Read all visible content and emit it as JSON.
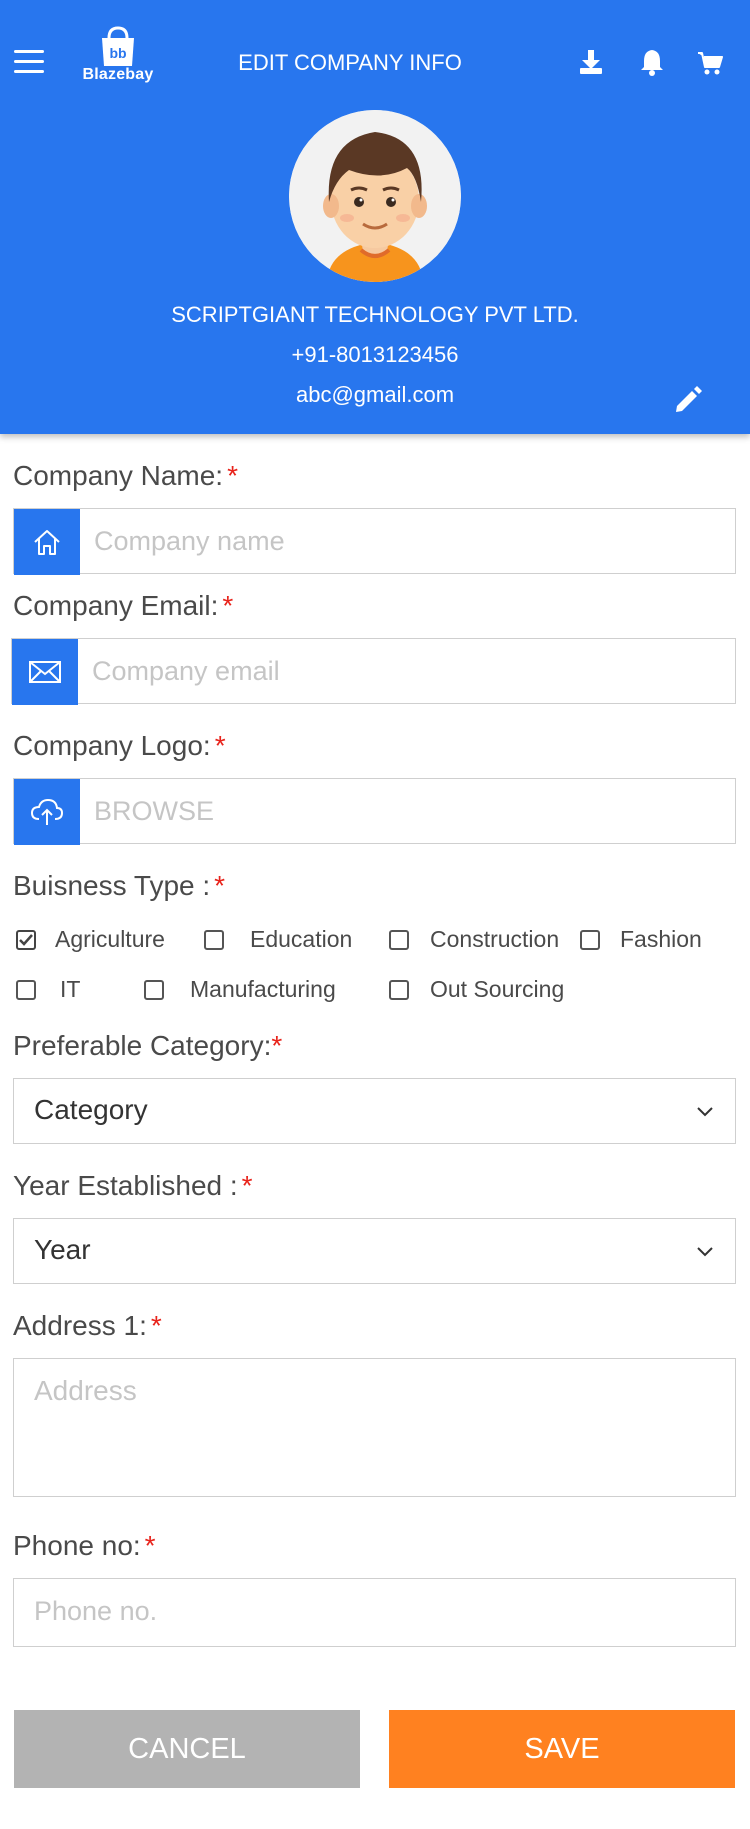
{
  "header": {
    "title": "EDIT COMPANY INFO",
    "logo_text": "Blazebay",
    "company_name": "SCRIPTGIANT TECHNOLOGY PVT LTD.",
    "phone": "+91-8013123456",
    "email": "abc@gmail.com"
  },
  "form": {
    "company_name": {
      "label": "Company Name:",
      "required": "*",
      "placeholder": "Company name",
      "icon": "home-icon"
    },
    "company_email": {
      "label": "Company Email:",
      "required": "*",
      "placeholder": "Company email",
      "icon": "envelope-icon"
    },
    "company_logo": {
      "label": "Company Logo:",
      "required": "*",
      "placeholder": "BROWSE",
      "icon": "cloud-upload-icon"
    },
    "business_type": {
      "label": "Buisness Type :",
      "required": "*",
      "options": [
        {
          "label": "Agriculture",
          "checked": true
        },
        {
          "label": "Education",
          "checked": false
        },
        {
          "label": "Construction",
          "checked": false
        },
        {
          "label": "Fashion",
          "checked": false
        },
        {
          "label": "IT",
          "checked": false
        },
        {
          "label": "Manufacturing",
          "checked": false
        },
        {
          "label": "Out Sourcing",
          "checked": false
        }
      ]
    },
    "category": {
      "label": "Preferable Category:",
      "required": "*",
      "value": "Category"
    },
    "year": {
      "label": "Year Established :",
      "required": "*",
      "value": "Year"
    },
    "address": {
      "label": "Address 1:",
      "required": "*",
      "placeholder": "Address"
    },
    "phone": {
      "label": "Phone no:",
      "required": "*",
      "placeholder": "Phone no."
    }
  },
  "actions": {
    "cancel": "CANCEL",
    "save": "SAVE"
  },
  "colors": {
    "primary": "#2876ee",
    "accent": "#ff8120",
    "cancel": "#b3b3b3",
    "required": "#e8231b"
  }
}
